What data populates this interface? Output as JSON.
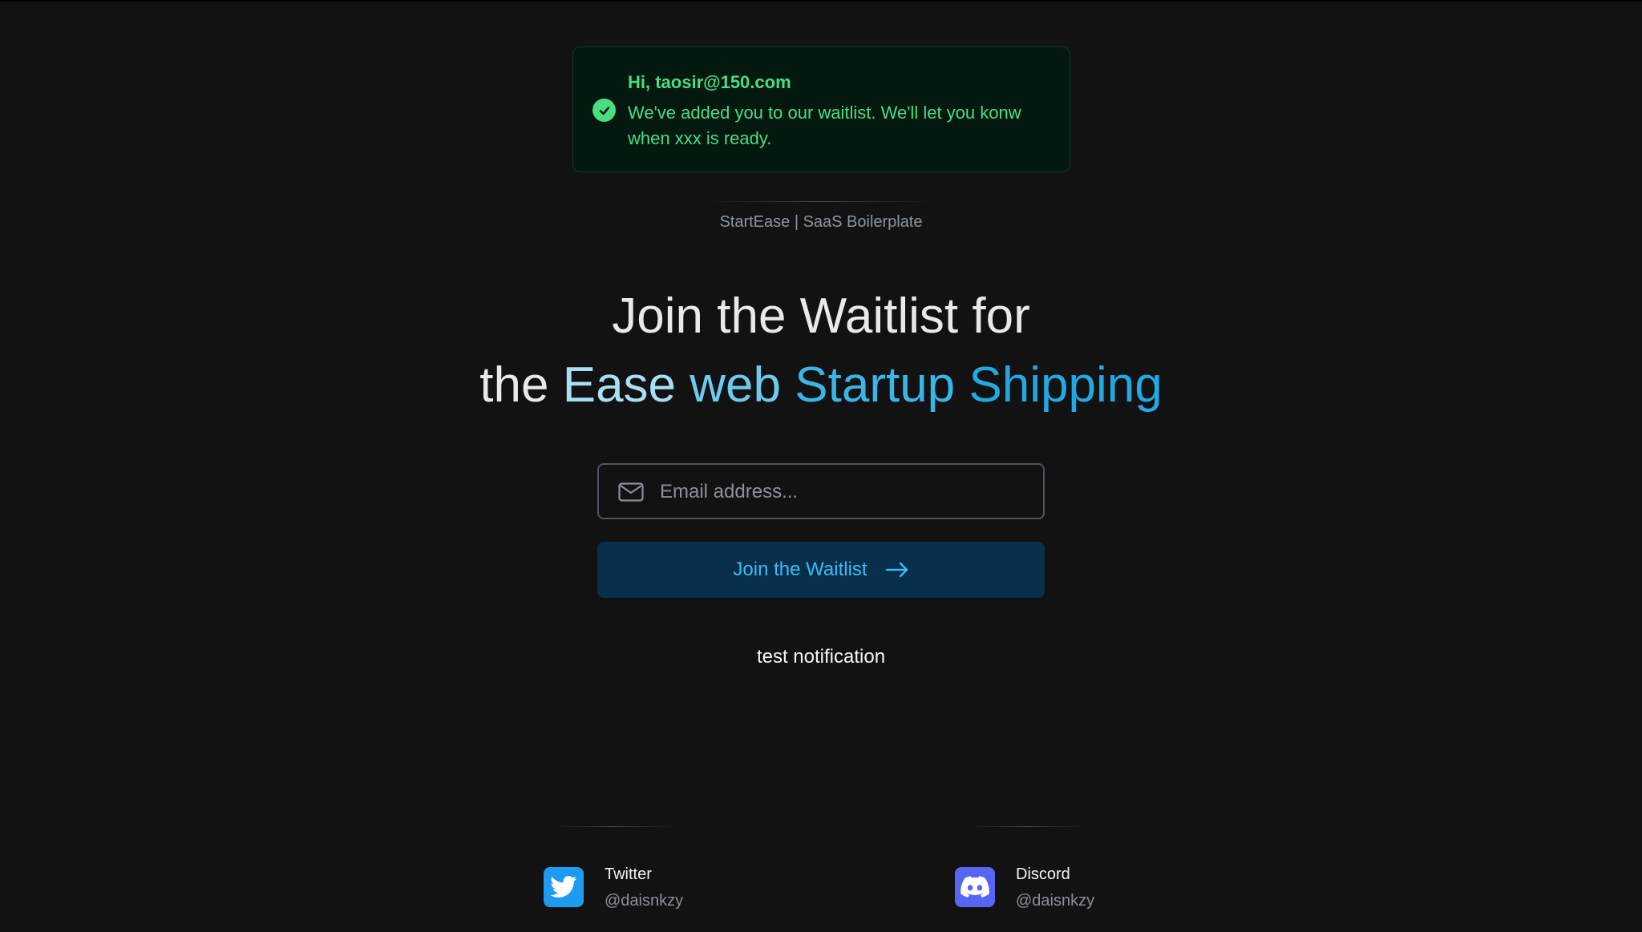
{
  "notification": {
    "title": "Hi, taosir@150.com",
    "message": "We've added you to our waitlist. We'll let you konw when xxx is ready.",
    "icon": "check-circle-icon",
    "color": "#4ade80"
  },
  "brand": "StartEase | SaaS Boilerplate",
  "headline": {
    "line1": "Join the Waitlist for",
    "line2_prefix": "the",
    "word_ease": "Ease",
    "word_web": "web",
    "word_startup": "Startup",
    "word_shipping": "Shipping"
  },
  "form": {
    "email_placeholder": "Email address...",
    "email_value": "",
    "submit_label": "Join the Waitlist",
    "accent": "#38bdf8"
  },
  "test_notification": "test notification",
  "socials": [
    {
      "name": "Twitter",
      "handle": "@daisnkzy",
      "icon": "twitter-icon",
      "color": "#1d9bf0"
    },
    {
      "name": "Discord",
      "handle": "@daisnkzy",
      "icon": "discord-icon",
      "color": "#5865f2"
    }
  ]
}
